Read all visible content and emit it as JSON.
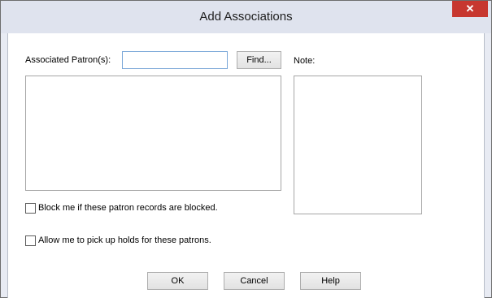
{
  "dialog": {
    "title": "Add Associations",
    "close_label": "✕"
  },
  "form": {
    "associated_patrons_label": "Associated Patron(s):",
    "associated_patrons_value": "",
    "find_button": "Find...",
    "note_label": "Note:",
    "block_checkbox": {
      "label": "Block me if these patron records are blocked.",
      "checked": false
    },
    "pickup_checkbox": {
      "label": "Allow me to pick up holds for these patrons.",
      "checked": false
    }
  },
  "buttons": {
    "ok": "OK",
    "cancel": "Cancel",
    "help": "Help"
  }
}
